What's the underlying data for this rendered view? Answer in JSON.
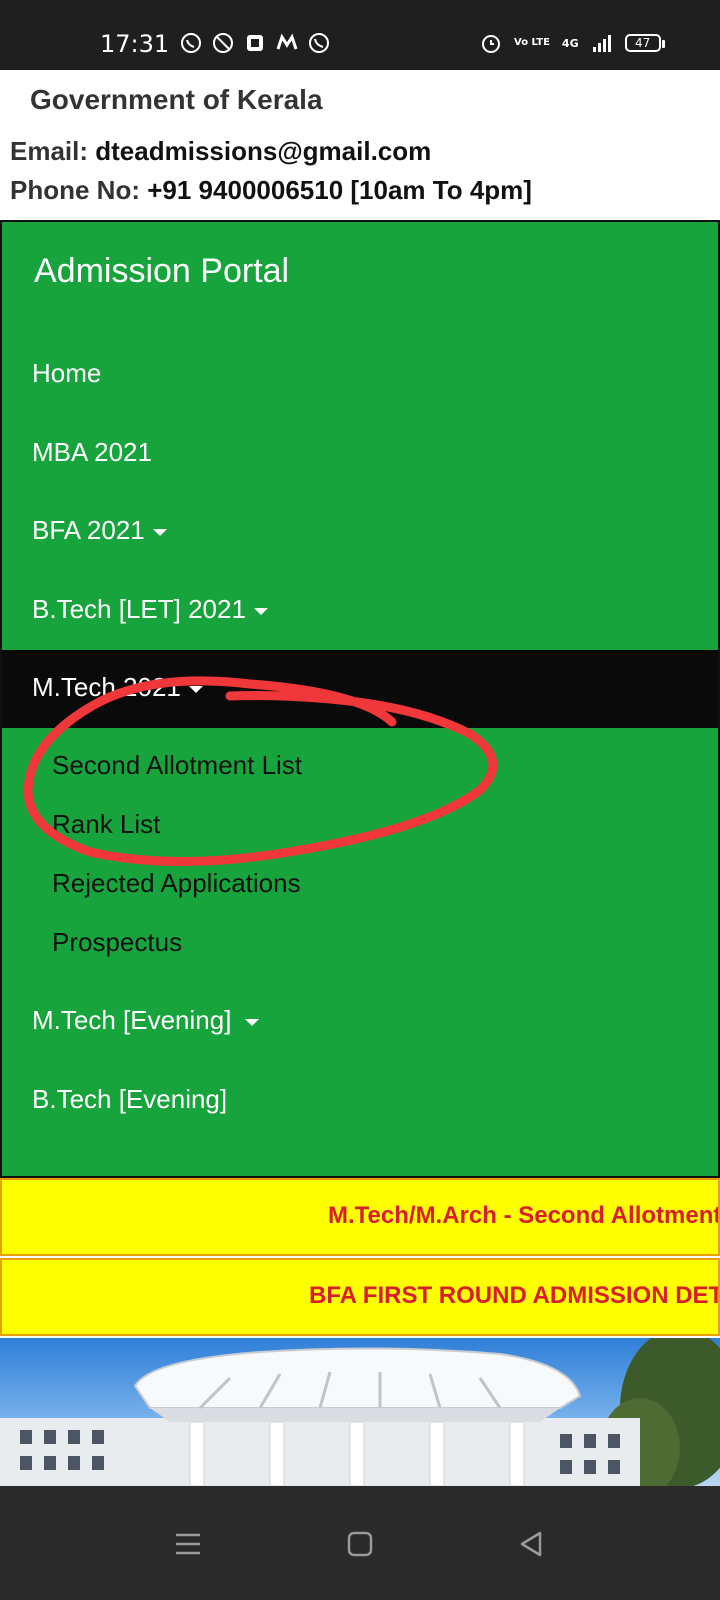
{
  "status_bar": {
    "time": "17:31",
    "network": "4G",
    "volte": "Vo LTE",
    "battery": "47",
    "left_icons": [
      "whatsapp-icon",
      "location-off-icon",
      "notification-app-icon",
      "myntra-icon",
      "phone-call-icon"
    ],
    "right_icons": [
      "alarm-icon",
      "volte-icon",
      "signal-4g-icon",
      "signal-bars-icon",
      "battery-icon"
    ]
  },
  "header": {
    "title": "Government of Kerala",
    "email_label": "Email:",
    "email_value": "dteadmissions@gmail.com",
    "phone_label": "Phone No:",
    "phone_value": "+91 9400006510 [10am To 4pm]"
  },
  "nav": {
    "brand": "Admission Portal",
    "items": [
      {
        "label": "Home",
        "dropdown": false
      },
      {
        "label": "MBA 2021",
        "dropdown": false
      },
      {
        "label": "BFA 2021",
        "dropdown": true
      },
      {
        "label": "B.Tech [LET] 2021",
        "dropdown": true
      },
      {
        "label": "M.Tech 2021",
        "dropdown": true,
        "expanded": true
      },
      {
        "label": "M.Tech [Evening]",
        "dropdown": true
      },
      {
        "label": "B.Tech [Evening]",
        "dropdown": false
      }
    ],
    "submenu": [
      "Second Allotment List",
      "Rank List",
      "Rejected Applications",
      "Prospectus"
    ]
  },
  "marquees": [
    "M.Tech/M.Arch - Second Allotment",
    "BFA FIRST ROUND ADMISSION DETAILS"
  ],
  "colors": {
    "nav_green": "#17a43c",
    "marquee_bg": "#ffff00",
    "marquee_text": "#d81e2a",
    "annotation_red": "#f0373a"
  }
}
